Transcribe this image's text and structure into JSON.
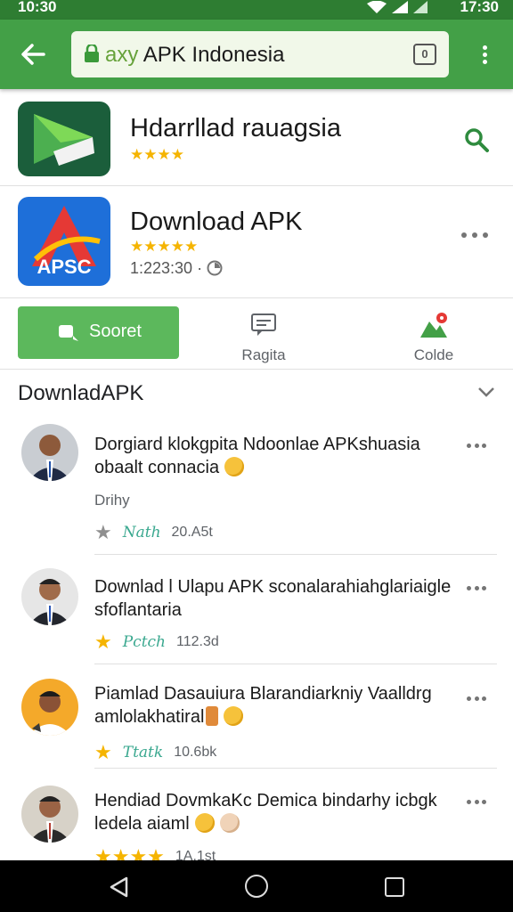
{
  "status_bar": {
    "time_left": "10:30",
    "time_right": "17:30"
  },
  "browser": {
    "url_prefix": "axy",
    "url_title": " APK Indonesia",
    "tabs_count": "0"
  },
  "apps": [
    {
      "title": "Hdarrllad rauagsia",
      "stars": "★★★★"
    },
    {
      "title": "Download APK",
      "stars": "★★★★★",
      "meta": "1:223:30 ·",
      "icon_text": "APSC"
    }
  ],
  "actions": {
    "primary_label": "Sooret",
    "secondary": [
      {
        "label": "Ragita"
      },
      {
        "label": "Colde"
      }
    ]
  },
  "section_title": "DownladAPK",
  "items": [
    {
      "text": "Dorgiard klokgpita Ndoonlae APKshuasia obaalt connacia",
      "sub": "Drihy",
      "star": "★",
      "tag": "Nath",
      "count": "20.A5t",
      "emoji": "grin"
    },
    {
      "text": "Downlad l Ulapu APK sconalarahiahglariaigle sfoflantaria",
      "star": "★",
      "tag": "Pctch",
      "count": "112.3d"
    },
    {
      "text": "Piamlad Dasauiura Blarandiarkniy Vaalldrg amlolakhatiral",
      "star": "★",
      "tag": "Ttatk",
      "count": "10.6bk",
      "emoji": "grin"
    },
    {
      "text": "Hendiad DovmkaKc Demica bindarhy icbgk ledela aiaml",
      "star": "★★★★",
      "tag": "",
      "count": "1A.1st",
      "emoji": "grin"
    }
  ],
  "colors": {
    "brand_green": "#43a047",
    "status_green": "#2e7d32",
    "button_green": "#5cb85c",
    "star_yellow": "#f5b400"
  }
}
